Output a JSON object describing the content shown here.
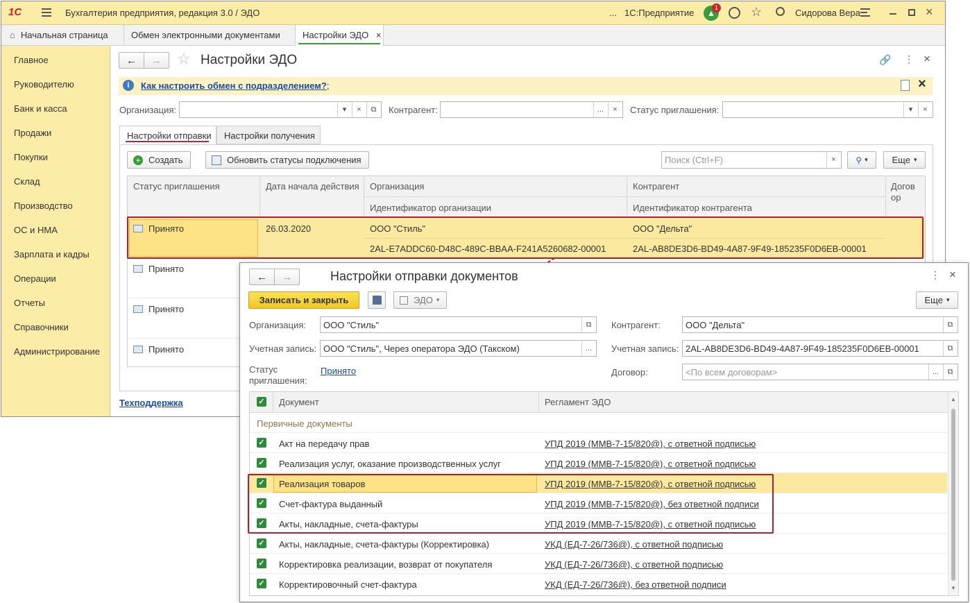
{
  "titlebar": {
    "app_title": "Бухгалтерия предприятия, редакция 3.0 / ЭДО",
    "ellipsis": "...",
    "platform": "1С:Предприятие",
    "notification_count": "1",
    "user": "Сидорова Вера"
  },
  "tabs": [
    {
      "label": "Начальная страница"
    },
    {
      "label": "Обмен электронными документами"
    },
    {
      "label": "Настройки ЭДО"
    }
  ],
  "sidebar": {
    "items": [
      {
        "label": "Главное"
      },
      {
        "label": "Руководителю"
      },
      {
        "label": "Банк и касса"
      },
      {
        "label": "Продажи"
      },
      {
        "label": "Покупки"
      },
      {
        "label": "Склад"
      },
      {
        "label": "Производство"
      },
      {
        "label": "ОС и НМА"
      },
      {
        "label": "Зарплата и кадры"
      },
      {
        "label": "Операции"
      },
      {
        "label": "Отчеты"
      },
      {
        "label": "Справочники"
      },
      {
        "label": "Администрирование"
      }
    ]
  },
  "form": {
    "title": "Настройки ЭДО",
    "hint_link": "Как настроить обмен с подразделением?",
    "hint_suffix": ";",
    "filters": {
      "org_label": "Организация:",
      "counterparty_label": "Контрагент:",
      "status_label": "Статус приглашения:"
    },
    "subtabs": [
      {
        "label": "Настройки отправки"
      },
      {
        "label": "Настройки получения"
      }
    ],
    "toolbar": {
      "create": "Создать",
      "refresh": "Обновить статусы подключения",
      "search_placeholder": "Поиск (Ctrl+F)",
      "more": "Еще"
    },
    "table": {
      "headers": {
        "status": "Статус приглашения",
        "date": "Дата начала действия",
        "org": "Организация",
        "org_id": "Идентификатор организации",
        "counterparty": "Контрагент",
        "counterparty_id": "Идентификатор контрагента",
        "contract_line1": "Догов",
        "contract_line2": "ор"
      },
      "rows": [
        {
          "status": "Принято",
          "date": "26.03.2020",
          "org": "ООО \"Стиль\"",
          "org_id": "2AL-E7ADDC60-D48C-489C-BBAA-F241A5260682-00001",
          "counterparty": "ООО \"Дельта\"",
          "counterparty_id": "2AL-AB8DE3D6-BD49-4A87-9F49-185235F0D6EB-00001"
        },
        {
          "status": "Принято"
        },
        {
          "status": "Принято"
        },
        {
          "status": "Принято"
        }
      ]
    },
    "support_link": "Техподдержка"
  },
  "dialog": {
    "title": "Настройки отправки документов",
    "save_close": "Записать и закрыть",
    "edo_menu": "ЭДО",
    "more": "Еще",
    "fields": {
      "org_label": "Организация:",
      "org_value": "ООО \"Стиль\"",
      "account_label": "Учетная запись:",
      "account_value": "ООО \"Стиль\", Через оператора ЭДО (Такском)",
      "status_label_1": "Статус",
      "status_label_2": "приглашения:",
      "status_value": "Принято",
      "cp_label": "Контрагент:",
      "cp_value": "ООО \"Дельта\"",
      "cp_account_label": "Учетная запись:",
      "cp_account_value": "2AL-AB8DE3D6-BD49-4A87-9F49-185235F0D6EB-00001",
      "contract_label": "Договор:",
      "contract_placeholder": "<По всем договорам>"
    },
    "table": {
      "headers": {
        "document": "Документ",
        "regulation": "Регламент ЭДО"
      },
      "group": "Первичные документы",
      "rows": [
        {
          "doc": "Акт на передачу прав",
          "reg": "УПД 2019 (ММВ-7-15/820@), с ответной подписью"
        },
        {
          "doc": "Реализация услуг, оказание производственных услуг",
          "reg": "УПД 2019 (ММВ-7-15/820@), с ответной подписью"
        },
        {
          "doc": "Реализация товаров",
          "reg": "УПД 2019 (ММВ-7-15/820@), с ответной подписью"
        },
        {
          "doc": "Счет-фактура выданный",
          "reg": "УПД 2019 (ММВ-7-15/820@), без ответной подписи"
        },
        {
          "doc": "Акты, накладные, счета-фактуры",
          "reg": "УПД 2019 (ММВ-7-15/820@), с ответной подписью"
        },
        {
          "doc": "Акты, накладные, счета-фактуры (Корректировка)",
          "reg": "УКД (ЕД-7-26/736@), с ответной подписью"
        },
        {
          "doc": "Корректировка реализации, возврат от покупателя",
          "reg": "УКД (ЕД-7-26/736@), с ответной подписью"
        },
        {
          "doc": "Корректировочный счет-фактура",
          "reg": "УКД (ЕД-7-26/736@), без ответной подписи"
        }
      ]
    }
  },
  "colors": {
    "accent_yellow": "#fbeda8",
    "selection": "#fbe9a0",
    "highlight_frame": "#b1202e",
    "link": "#1a4d9c",
    "check": "#2e8b3a"
  }
}
